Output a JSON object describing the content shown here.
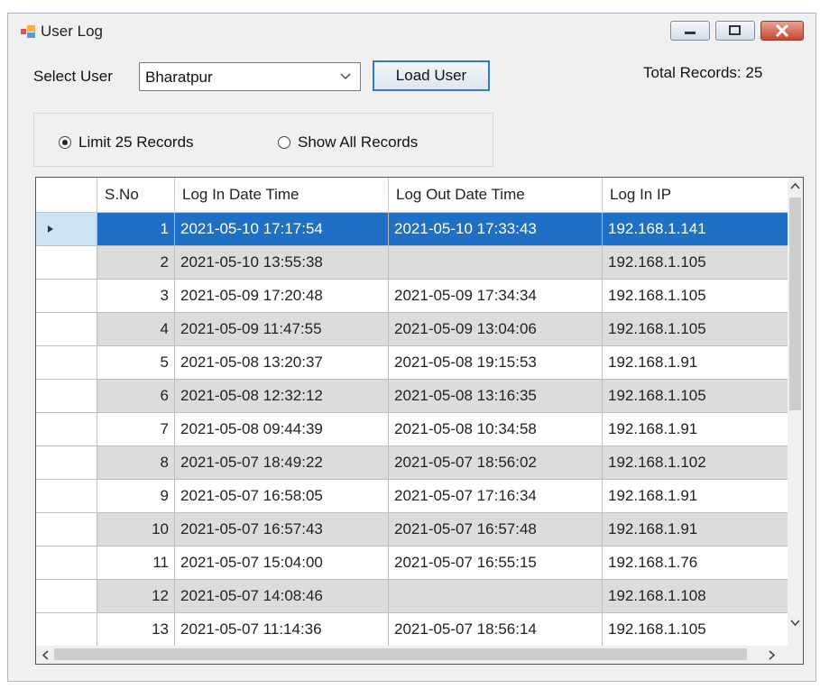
{
  "window": {
    "title": "User Log"
  },
  "select_user": {
    "label": "Select User",
    "value": "Bharatpur"
  },
  "load_button": "Load User",
  "total_records": "Total Records: 25",
  "radios": {
    "limit": "Limit 25 Records",
    "show_all": "Show All Records",
    "selected": "limit"
  },
  "grid": {
    "columns": [
      "S.No",
      "Log In Date Time",
      "Log Out Date Time",
      "Log In IP"
    ],
    "rows": [
      [
        "1",
        "2021-05-10 17:17:54",
        "2021-05-10 17:33:43",
        "192.168.1.141"
      ],
      [
        "2",
        "2021-05-10 13:55:38",
        "",
        "192.168.1.105"
      ],
      [
        "3",
        "2021-05-09 17:20:48",
        "2021-05-09 17:34:34",
        "192.168.1.105"
      ],
      [
        "4",
        "2021-05-09 11:47:55",
        "2021-05-09 13:04:06",
        "192.168.1.105"
      ],
      [
        "5",
        "2021-05-08 13:20:37",
        "2021-05-08 19:15:53",
        "192.168.1.91"
      ],
      [
        "6",
        "2021-05-08 12:32:12",
        "2021-05-08 13:16:35",
        "192.168.1.105"
      ],
      [
        "7",
        "2021-05-08 09:44:39",
        "2021-05-08 10:34:58",
        "192.168.1.91"
      ],
      [
        "8",
        "2021-05-07 18:49:22",
        "2021-05-07 18:56:02",
        "192.168.1.102"
      ],
      [
        "9",
        "2021-05-07 16:58:05",
        "2021-05-07 17:16:34",
        "192.168.1.91"
      ],
      [
        "10",
        "2021-05-07 16:57:43",
        "2021-05-07 16:57:48",
        "192.168.1.91"
      ],
      [
        "11",
        "2021-05-07 15:04:00",
        "2021-05-07 16:55:15",
        "192.168.1.76"
      ],
      [
        "12",
        "2021-05-07 14:08:46",
        "",
        "192.168.1.108"
      ],
      [
        "13",
        "2021-05-07 11:14:36",
        "2021-05-07 18:56:14",
        "192.168.1.105"
      ]
    ],
    "selected_row": 0,
    "colors": {
      "selection": "#1f6fc4",
      "alt_row": "#dcdcdc",
      "row_header_selected": "#cfe3f6"
    }
  },
  "icons": {
    "app": "app-icon",
    "minimize": "minimize-icon",
    "maximize": "maximize-icon",
    "close": "close-icon",
    "dropdown": "chevron-down-icon",
    "row_pointer": "row-pointer-icon",
    "scroll_up": "scroll-up-arrow-icon",
    "scroll_down": "scroll-down-arrow-icon",
    "scroll_left": "scroll-left-arrow-icon",
    "scroll_right": "scroll-right-arrow-icon"
  }
}
